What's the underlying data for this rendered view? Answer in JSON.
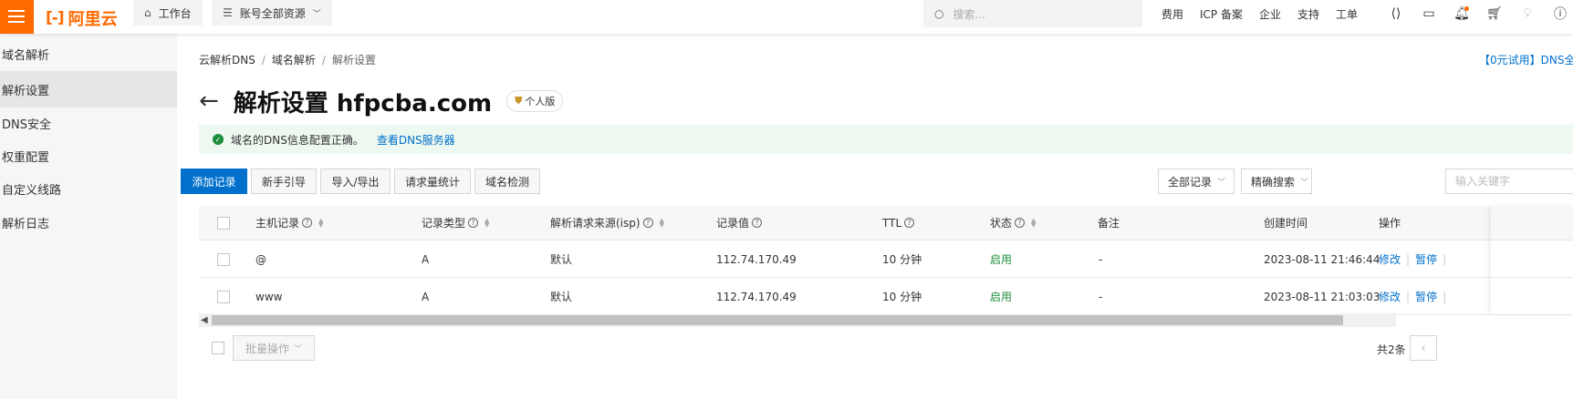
{
  "topbar": {
    "logo_text": "阿里云",
    "workbench": "工作台",
    "resources": "账号全部资源",
    "search_placeholder": "搜索...",
    "links": [
      "费用",
      "ICP 备案",
      "企业",
      "支持",
      "工单"
    ],
    "accent_color": "#ff6a00"
  },
  "sidebar": {
    "items": [
      {
        "label": "域名解析",
        "active": false
      },
      {
        "label": "解析设置",
        "active": true
      },
      {
        "label": "DNS安全",
        "active": false
      },
      {
        "label": "权重配置",
        "active": false
      },
      {
        "label": "自定义线路",
        "active": false
      },
      {
        "label": "解析日志",
        "active": false
      }
    ]
  },
  "breadcrumb": [
    "云解析DNS",
    "域名解析",
    "解析设置"
  ],
  "promo_text": "【0元试用】DNS全",
  "title": "解析设置 hfpcba.com",
  "edition_badge": "个人版",
  "alert": {
    "message": "域名的DNS信息配置正确。",
    "link": "查看DNS服务器"
  },
  "toolbar": {
    "add_record": "添加记录",
    "guide": "新手引导",
    "import_export": "导入/导出",
    "request_stats": "请求量统计",
    "domain_check": "域名检测",
    "filter_all": "全部记录",
    "search_mode": "精确搜索",
    "keyword_placeholder": "输入关键字"
  },
  "table": {
    "headers": {
      "host": "主机记录",
      "type": "记录类型",
      "source": "解析请求来源(isp)",
      "value": "记录值",
      "ttl": "TTL",
      "status": "状态",
      "remark": "备注",
      "created": "创建时间",
      "ops": "操作"
    },
    "rows": [
      {
        "host": "@",
        "type": "A",
        "source": "默认",
        "value": "112.74.170.49",
        "ttl": "10 分钟",
        "status": "启用",
        "remark": "-",
        "created": "2023-08-11 21:46:44",
        "op_edit": "修改",
        "op_pause": "暂停"
      },
      {
        "host": "www",
        "type": "A",
        "source": "默认",
        "value": "112.74.170.49",
        "ttl": "10 分钟",
        "status": "启用",
        "remark": "-",
        "created": "2023-08-11 21:03:03",
        "op_edit": "修改",
        "op_pause": "暂停"
      }
    ]
  },
  "footer": {
    "batch": "批量操作",
    "total": "共2条"
  }
}
